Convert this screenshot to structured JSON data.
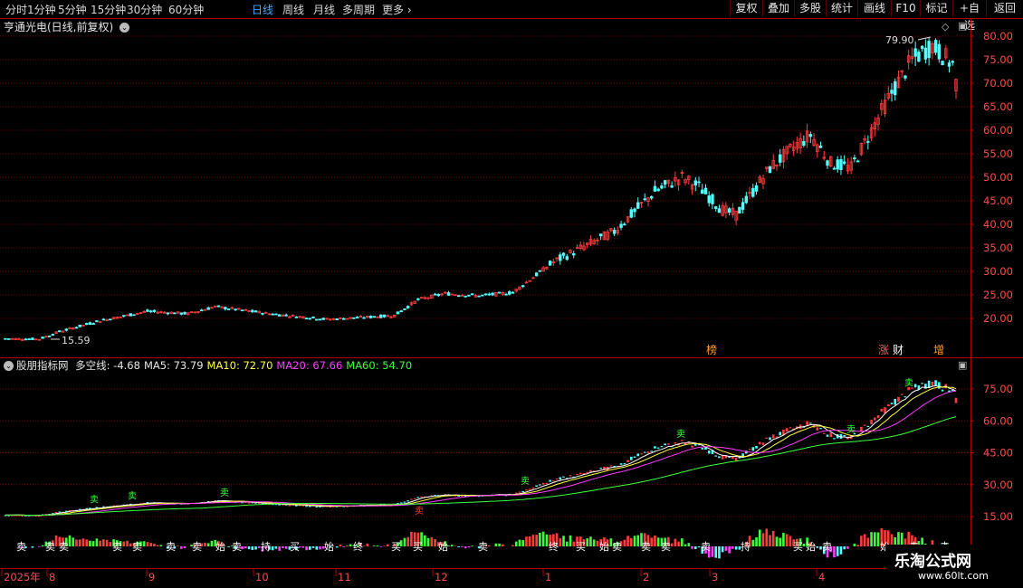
{
  "toolbar": {
    "period_tabs": [
      "分时",
      "1分钟",
      "5分钟",
      "15分钟",
      "30分钟",
      "60分钟",
      "日线",
      "周线",
      "月线",
      "多周期",
      "更多"
    ],
    "active_tab": "日线",
    "right_buttons": [
      "复权",
      "叠加",
      "多股",
      "统计",
      "画线",
      "F10",
      "标记",
      "+自选",
      "返回"
    ]
  },
  "stock": {
    "title": "亨通光电(日线,前复权)"
  },
  "indicator": {
    "name": "股朋指标网",
    "values": [
      {
        "label": "多空线: -4.68",
        "color": "#e6e6e6"
      },
      {
        "label": "MA5: 73.79",
        "color": "#e6e6e6"
      },
      {
        "label": "MA10: 72.70",
        "color": "#ffff3c"
      },
      {
        "label": "MA20: 67.66",
        "color": "#ff3cff"
      },
      {
        "label": "MA60: 54.70",
        "color": "#3cff3c"
      }
    ]
  },
  "price_axis": [
    "80.00",
    "75.00",
    "70.00",
    "65.00",
    "60.00",
    "55.00",
    "50.00",
    "45.00",
    "40.00",
    "35.00",
    "30.00",
    "25.00",
    "20.00"
  ],
  "ind_axis": [
    "75.00",
    "60.00",
    "45.00",
    "30.00",
    "15.00"
  ],
  "date_axis": [
    "2025年",
    "8",
    "9",
    "10",
    "11",
    "12",
    "1",
    "2",
    "3",
    "4"
  ],
  "annotations": {
    "high": "79.90",
    "low": "15.59"
  },
  "badges": [
    {
      "text": "榜",
      "color": "#ff9b2a"
    },
    {
      "text": "涨",
      "color": "#ff5a5a"
    },
    {
      "text": "财",
      "color": "#ffffff"
    },
    {
      "text": "增",
      "color": "#ff9b2a"
    }
  ],
  "signals": {
    "sell": "卖",
    "buy": "买",
    "start": "始",
    "end": "终",
    "hold": "持"
  },
  "watermark": {
    "title": "乐淘公式网",
    "url": "www.60lt.com"
  },
  "colors": {
    "up": "#ff3c3c",
    "down": "#54ffff",
    "grid": "#7a0000",
    "axis": "#b00000",
    "ma10": "#ffff3c",
    "ma20": "#ff3cff",
    "ma60": "#3cff3c",
    "ma5": "#ffffff"
  },
  "chart_data": {
    "type": "candlestick",
    "price_range": [
      15.59,
      79.9
    ],
    "note_points": [
      {
        "label": "low",
        "value": 15.59
      },
      {
        "label": "high",
        "value": 79.9
      }
    ],
    "indicator_latest": {
      "多空线": -4.68,
      "MA5": 73.79,
      "MA10": 72.7,
      "MA20": 67.66,
      "MA60": 54.7
    }
  }
}
